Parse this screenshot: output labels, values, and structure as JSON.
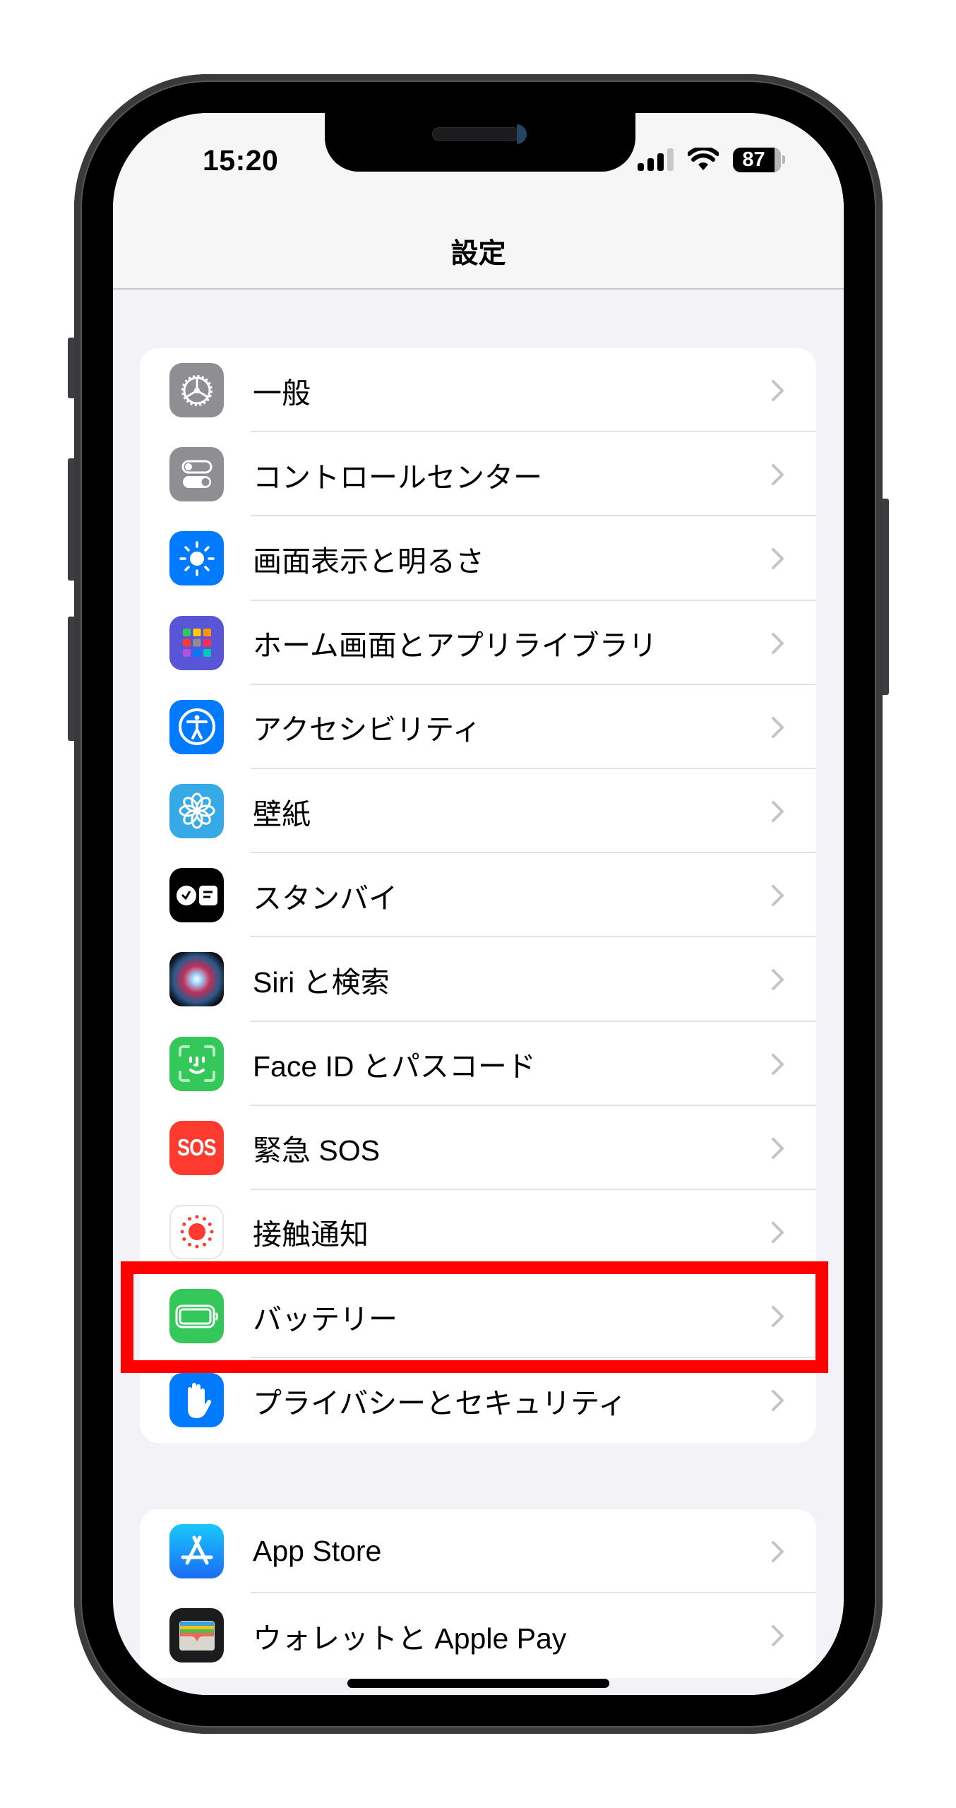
{
  "status_bar": {
    "time": "15:20",
    "signal_bars_filled": 3,
    "signal_bars_total": 4,
    "wifi": "wifi-icon",
    "battery_percent": "87"
  },
  "header": {
    "title": "設定"
  },
  "groups": [
    {
      "items": [
        {
          "label": "一般",
          "icon": "gear-icon",
          "color": "#8e8e93"
        },
        {
          "label": "コントロールセンター",
          "icon": "toggle-switches-icon",
          "color": "#8e8e93"
        },
        {
          "label": "画面表示と明るさ",
          "icon": "sun-icon",
          "color": "#007aff"
        },
        {
          "label": "ホーム画面とアプリライブラリ",
          "icon": "app-grid-icon",
          "color": "#5856d6"
        },
        {
          "label": "アクセシビリティ",
          "icon": "accessibility-person-icon",
          "color": "#007aff"
        },
        {
          "label": "壁紙",
          "icon": "flower-icon",
          "color": "#36aae6"
        },
        {
          "label": "スタンバイ",
          "icon": "standby-clock-icon",
          "color": "#000000"
        },
        {
          "label": "Siri と検索",
          "icon": "siri-orb-icon",
          "color": "#1a1a2e"
        },
        {
          "label": "Face ID とパスコード",
          "icon": "face-id-icon",
          "color": "#34c759"
        },
        {
          "label": "緊急 SOS",
          "icon": "sos-icon",
          "color": "#ff3b30",
          "icon_text": "SOS"
        },
        {
          "label": "接触通知",
          "icon": "exposure-notification-icon",
          "color": "#ffffff"
        },
        {
          "label": "バッテリー",
          "icon": "battery-icon",
          "color": "#34c759",
          "highlighted": true
        },
        {
          "label": "プライバシーとセキュリティ",
          "icon": "hand-icon",
          "color": "#007aff"
        }
      ]
    },
    {
      "items": [
        {
          "label": "App Store",
          "icon": "app-store-icon",
          "color": "#1a8cff"
        },
        {
          "label": "ウォレットと Apple Pay",
          "icon": "wallet-icon",
          "color": "#1c1c1e"
        }
      ]
    }
  ],
  "highlight": {
    "target": "バッテリー",
    "color": "#ff0000"
  }
}
